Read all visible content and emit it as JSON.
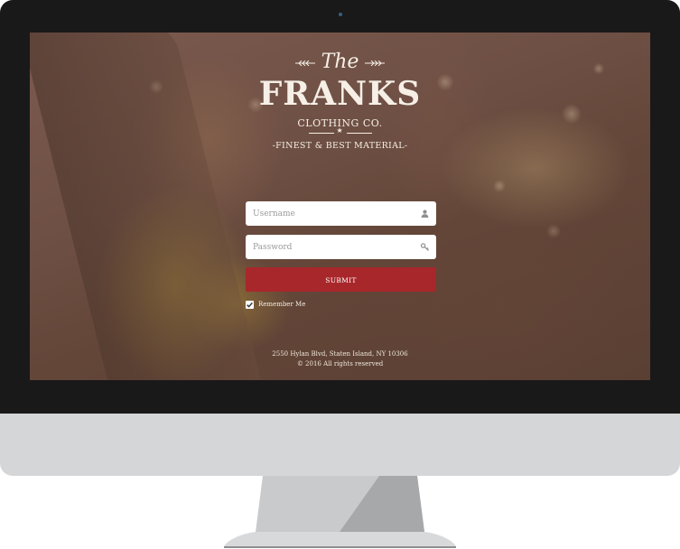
{
  "logo": {
    "the": "The",
    "name": "FRANKS",
    "subtitle": "CLOTHING CO.",
    "tagline": "-FINEST & BEST MATERIAL-"
  },
  "form": {
    "username_placeholder": "Username",
    "password_placeholder": "Password",
    "submit_label": "SUBMIT",
    "remember_label": "Remember Me",
    "remember_checked": true
  },
  "footer": {
    "address": "2550 Hylan Blvd, Staten Island, NY 10306",
    "copyright": "© 2016 All rights reserved"
  },
  "colors": {
    "submit": "#a8272b",
    "bezel": "#19191a",
    "chin": "#d5d6d8"
  },
  "icons": {
    "username": "user-icon",
    "password": "key-icon",
    "remember": "checkmark-icon"
  }
}
